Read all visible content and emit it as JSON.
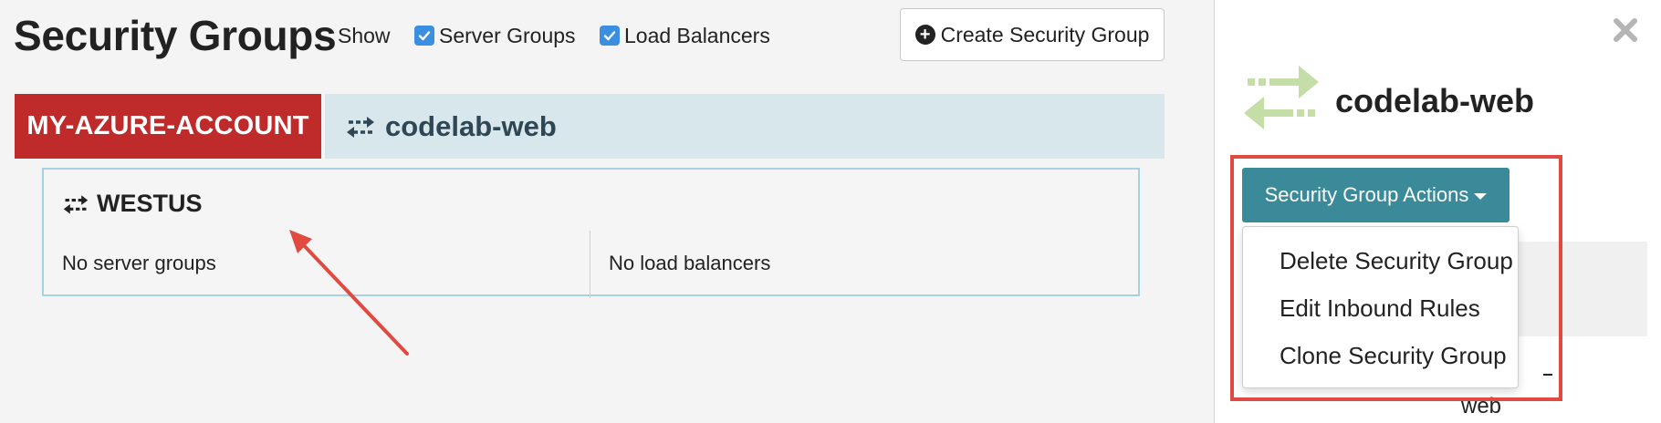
{
  "header": {
    "title": "Security Groups",
    "show_label": "Show",
    "filters": [
      {
        "label": "Server Groups",
        "checked": true
      },
      {
        "label": "Load Balancers",
        "checked": true
      }
    ],
    "create_button": "Create Security Group"
  },
  "account_tab": "MY-AZURE-ACCOUNT",
  "group": {
    "name": "codelab-web",
    "region": {
      "name": "WESTUS",
      "server_groups_text": "No server groups",
      "load_balancers_text": "No load balancers"
    }
  },
  "side_panel": {
    "title": "codelab-web",
    "actions_button": "Security Group Actions",
    "menu": [
      "Delete Security Group",
      "Edit Inbound Rules",
      "Clone Security Group"
    ],
    "partial_text": "web"
  },
  "colors": {
    "account_tab_bg": "#bf2a2a",
    "group_header_bg": "#d7e7ec",
    "actions_button_bg": "#3a8a9a",
    "checkbox_accent": "#3b8fe0",
    "annotation": "#e04a40",
    "logo_green": "#c5dea7"
  }
}
